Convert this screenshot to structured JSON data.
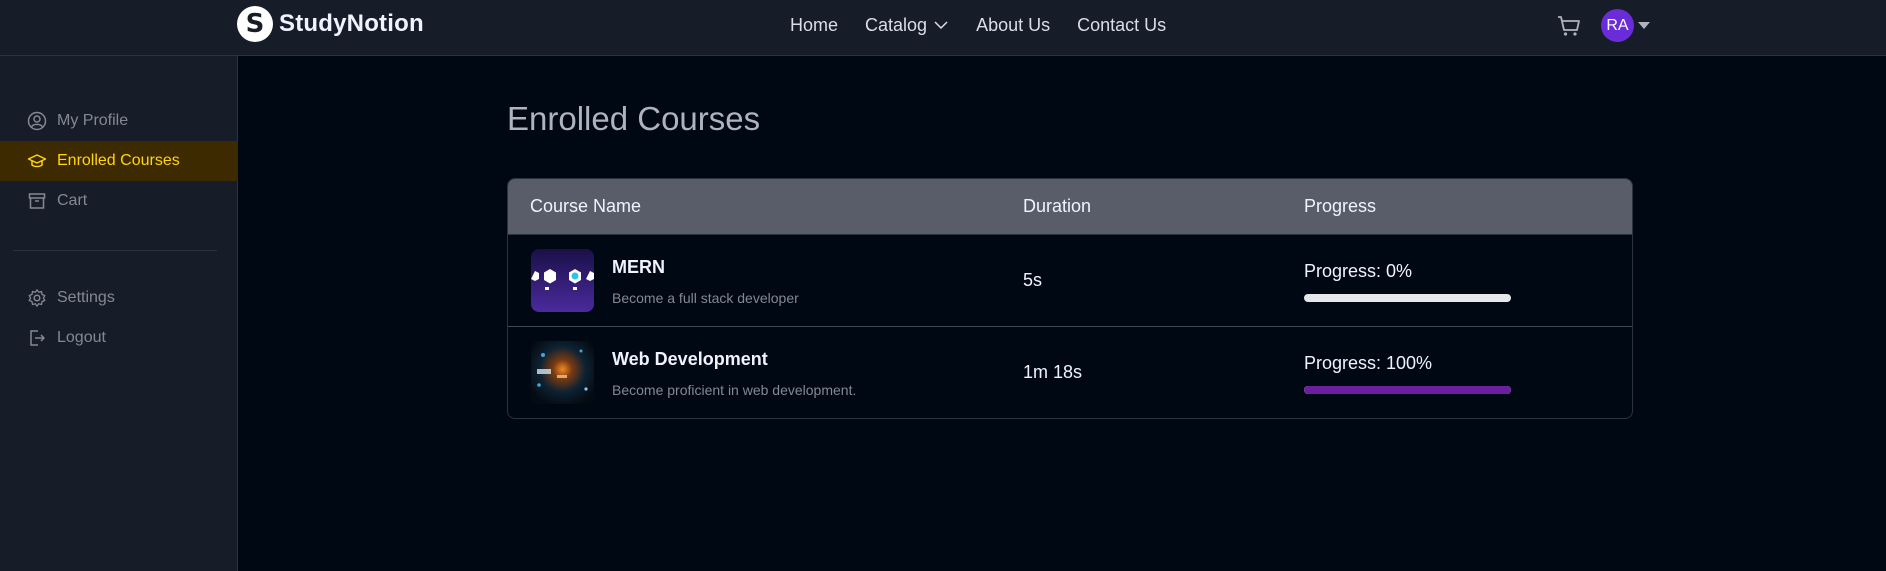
{
  "brand": {
    "logo_letter": "S",
    "name": "StudyNotion"
  },
  "nav": {
    "links": [
      "Home",
      "Catalog",
      "About Us",
      "Contact Us"
    ]
  },
  "user": {
    "initials": "RA"
  },
  "sidebar": {
    "items": [
      {
        "label": "My Profile",
        "icon": "user-circle-icon",
        "active": false
      },
      {
        "label": "Enrolled Courses",
        "icon": "graduation-cap-icon",
        "active": true
      },
      {
        "label": "Cart",
        "icon": "archive-box-icon",
        "active": false
      },
      {
        "label": "Settings",
        "icon": "gear-icon",
        "active": false
      },
      {
        "label": "Logout",
        "icon": "logout-icon",
        "active": false
      }
    ]
  },
  "main": {
    "title": "Enrolled Courses",
    "table": {
      "headers": [
        "Course Name",
        "Duration",
        "Progress"
      ],
      "rows": [
        {
          "name": "MERN",
          "description": "Become a full stack developer",
          "duration": "5s",
          "progress_label": "Progress: 0%",
          "progress": 0
        },
        {
          "name": "Web Development",
          "description": "Become proficient in web development.",
          "duration": "1m 18s",
          "progress_label": "Progress: 100%",
          "progress": 100
        }
      ]
    }
  },
  "colors": {
    "accent": "#FFD60A",
    "progress_fill": "#6B1E9E",
    "avatar": "#6A2BD9"
  }
}
